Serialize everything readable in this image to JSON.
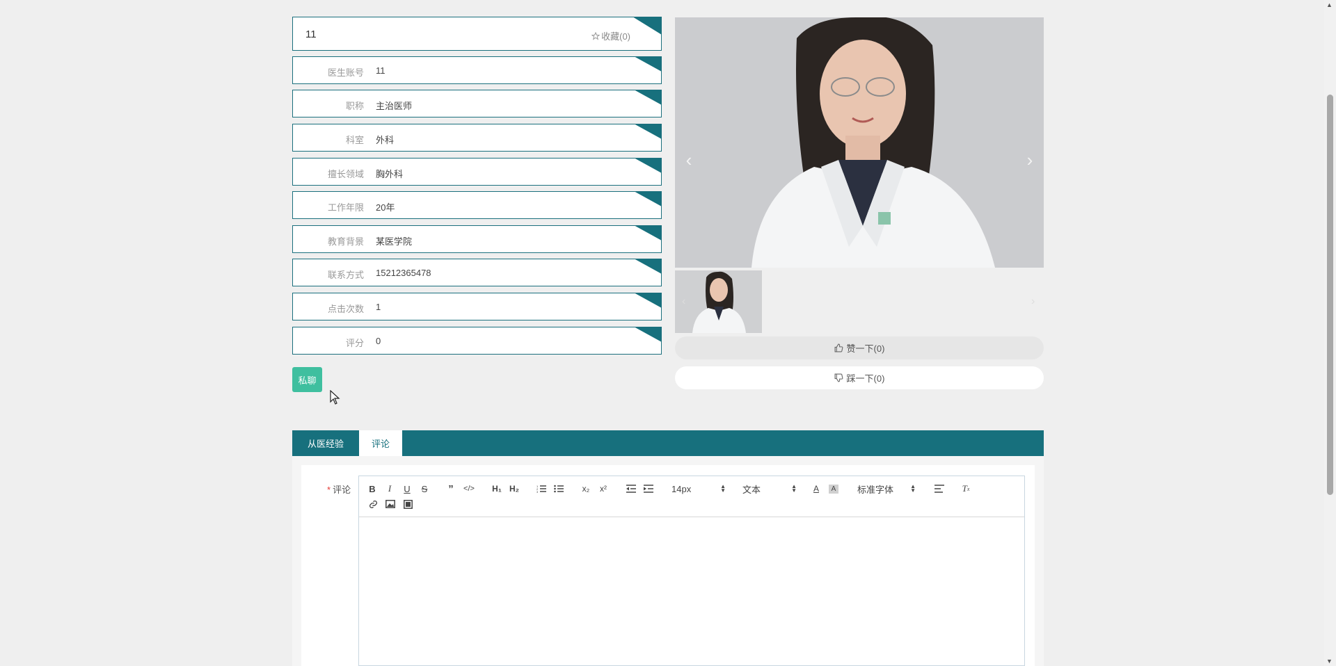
{
  "doctor": {
    "title": "11",
    "favorite_label": "收藏(0)",
    "fields": [
      {
        "label": "医生账号",
        "value": "11"
      },
      {
        "label": "职称",
        "value": "主治医师"
      },
      {
        "label": "科室",
        "value": "外科"
      },
      {
        "label": "擅长领域",
        "value": "胸外科"
      },
      {
        "label": "工作年限",
        "value": "20年"
      },
      {
        "label": "教育背景",
        "value": "某医学院"
      },
      {
        "label": "联系方式",
        "value": "15212365478"
      },
      {
        "label": "点击次数",
        "value": "1"
      },
      {
        "label": "评分",
        "value": "0"
      }
    ]
  },
  "actions": {
    "chat_label": "私聊",
    "like_label": "赞一下(0)",
    "dislike_label": "踩一下(0)"
  },
  "tabs": [
    {
      "label": "从医经验"
    },
    {
      "label": "评论"
    }
  ],
  "comment_form": {
    "required_mark": "*",
    "label": "评论",
    "font_size": "14px",
    "text_type": "文本",
    "font_family": "标准字体"
  },
  "colors": {
    "teal": "#17707d",
    "green_button": "#3fbf9f"
  }
}
